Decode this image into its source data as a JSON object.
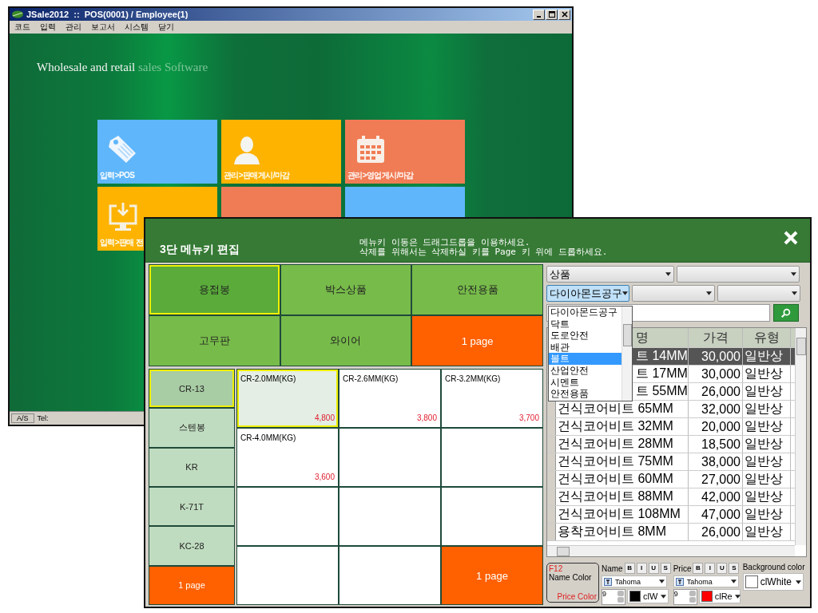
{
  "main_window": {
    "title": "JSale2012  ::  POS(0001) / Employee(1)",
    "menu": [
      "코드",
      "입력",
      "관리",
      "보고서",
      "시스템",
      "닫기"
    ],
    "tagline": {
      "main": "Wholesale and retail",
      "faded": "sales Software"
    },
    "tiles": [
      {
        "label": "입력>POS",
        "color": "#5fb6fb",
        "kind": "tag"
      },
      {
        "label": "관리>판매게시/마감",
        "color": "#fdb300",
        "kind": "person"
      },
      {
        "label": "관리>영업게시/마감",
        "color": "#f07c55",
        "kind": "calendar"
      },
      {
        "label": "입력>판매 전",
        "color": "#fdb300",
        "kind": "monitor"
      },
      {
        "color": "#f07c55",
        "kind": "blank"
      },
      {
        "color": "#5fb6fb",
        "kind": "blank"
      }
    ],
    "status_bar": [
      "A/S",
      "Tel:"
    ]
  },
  "dialog": {
    "title": "3단 메뉴키 편집",
    "message": [
      "메뉴키 이동은 드래그드롭을 이용하세요.",
      "삭제를 위해서는 삭제하실 키를 Page 키 위에 드롭하세요."
    ],
    "menu_keys": [
      {
        "label": "용접봉",
        "kind": "key",
        "selected": true
      },
      {
        "label": "박스상품",
        "kind": "key",
        "selected": false
      },
      {
        "label": "안전용품",
        "kind": "key",
        "selected": false
      },
      {
        "label": "고무판",
        "kind": "key",
        "selected": false
      },
      {
        "label": "와이어",
        "kind": "key",
        "selected": false
      },
      {
        "label": "1 page",
        "kind": "page",
        "selected": false
      }
    ],
    "sub_keys": [
      {
        "label": "CR-13",
        "kind": "key",
        "selected": true
      },
      {
        "label": "스텐봉",
        "kind": "key",
        "selected": false
      },
      {
        "label": "KR",
        "kind": "key",
        "selected": false
      },
      {
        "label": "K-71T",
        "kind": "key",
        "selected": false
      },
      {
        "label": "KC-28",
        "kind": "key",
        "selected": false
      },
      {
        "label": "1 page",
        "kind": "page",
        "selected": false
      }
    ],
    "items": [
      {
        "name": "CR-2.0MM(KG)",
        "price": "4,800",
        "kind": "item",
        "selected": true
      },
      {
        "name": "CR-2.6MM(KG)",
        "price": "3,800",
        "kind": "item",
        "selected": false
      },
      {
        "name": "CR-3.2MM(KG)",
        "price": "3,700",
        "kind": "item",
        "selected": false
      },
      {
        "name": "CR-4.0MM(KG)",
        "price": "3,600",
        "kind": "item",
        "selected": false
      },
      {
        "kind": "empty"
      },
      {
        "kind": "empty"
      },
      {
        "kind": "empty"
      },
      {
        "kind": "empty"
      },
      {
        "kind": "empty"
      },
      {
        "kind": "empty"
      },
      {
        "kind": "empty"
      },
      {
        "label": "1 page",
        "kind": "page"
      }
    ],
    "combos": [
      {
        "value": "상품",
        "open": false
      },
      {
        "open": false
      },
      {
        "value": "다이아몬드공구",
        "open": true
      },
      {
        "open": false
      },
      {
        "open": false
      }
    ],
    "dropdown": [
      {
        "label": "다이아몬드공구",
        "selected": false
      },
      {
        "label": "닥트",
        "selected": false
      },
      {
        "label": "도로안전",
        "selected": false
      },
      {
        "label": "배관",
        "selected": false
      },
      {
        "label": "볼트",
        "selected": true
      },
      {
        "label": "산업안전",
        "selected": false
      },
      {
        "label": "시멘트",
        "selected": false
      },
      {
        "label": "안전용품",
        "selected": false
      }
    ],
    "table": {
      "columns": [
        {
          "label": "명",
          "covered": true
        },
        {
          "label": "가격",
          "covered": false
        },
        {
          "label": "유형",
          "covered": false
        }
      ],
      "rows": [
        {
          "name": "트 14MM",
          "price": "30,000",
          "type": "일반상",
          "selected": true,
          "covered": true
        },
        {
          "name": "트 17MM",
          "price": "30,000",
          "type": "일반상",
          "selected": false,
          "covered": true
        },
        {
          "name": "트 55MM",
          "price": "26,000",
          "type": "일반상",
          "selected": false,
          "covered": true
        },
        {
          "name": "건식코어비트 65MM",
          "price": "32,000",
          "type": "일반상",
          "selected": false,
          "covered": false
        },
        {
          "name": "건식코어비트 32MM",
          "price": "20,000",
          "type": "일반상",
          "selected": false,
          "covered": false
        },
        {
          "name": "건식코어비트 28MM",
          "price": "18,500",
          "type": "일반상",
          "selected": false,
          "covered": false
        },
        {
          "name": "건식코어비트 75MM",
          "price": "38,000",
          "type": "일반상",
          "selected": false,
          "covered": false
        },
        {
          "name": "건식코어비트 60MM",
          "price": "27,000",
          "type": "일반상",
          "selected": false,
          "covered": false
        },
        {
          "name": "건식코어비트 88MM",
          "price": "42,000",
          "type": "일반상",
          "selected": false,
          "covered": false
        },
        {
          "name": "건식코어비트 108MM",
          "price": "47,000",
          "type": "일반상",
          "selected": false,
          "covered": false
        },
        {
          "name": "용착코어비트 8MM",
          "price": "26,000",
          "type": "일반상",
          "selected": false,
          "covered": false
        }
      ]
    },
    "format": {
      "hint": {
        "key": "F12",
        "name": "Name Color",
        "price": "Price Color"
      },
      "groups": [
        {
          "label": "Name",
          "kind": "text",
          "styles": [
            "B",
            "I",
            "U",
            "S"
          ],
          "font": "Tahoma",
          "size": "9",
          "color": "#000000",
          "color_name": "clW"
        },
        {
          "label": "Price",
          "kind": "text",
          "styles": [
            "B",
            "I",
            "U",
            "S"
          ],
          "font": "Tahoma",
          "size": "9",
          "color": "#ff0000",
          "color_name": "clRe"
        },
        {
          "label": "Background color",
          "kind": "background",
          "color": "#ffffff",
          "color_name": "clWhite"
        }
      ]
    }
  }
}
